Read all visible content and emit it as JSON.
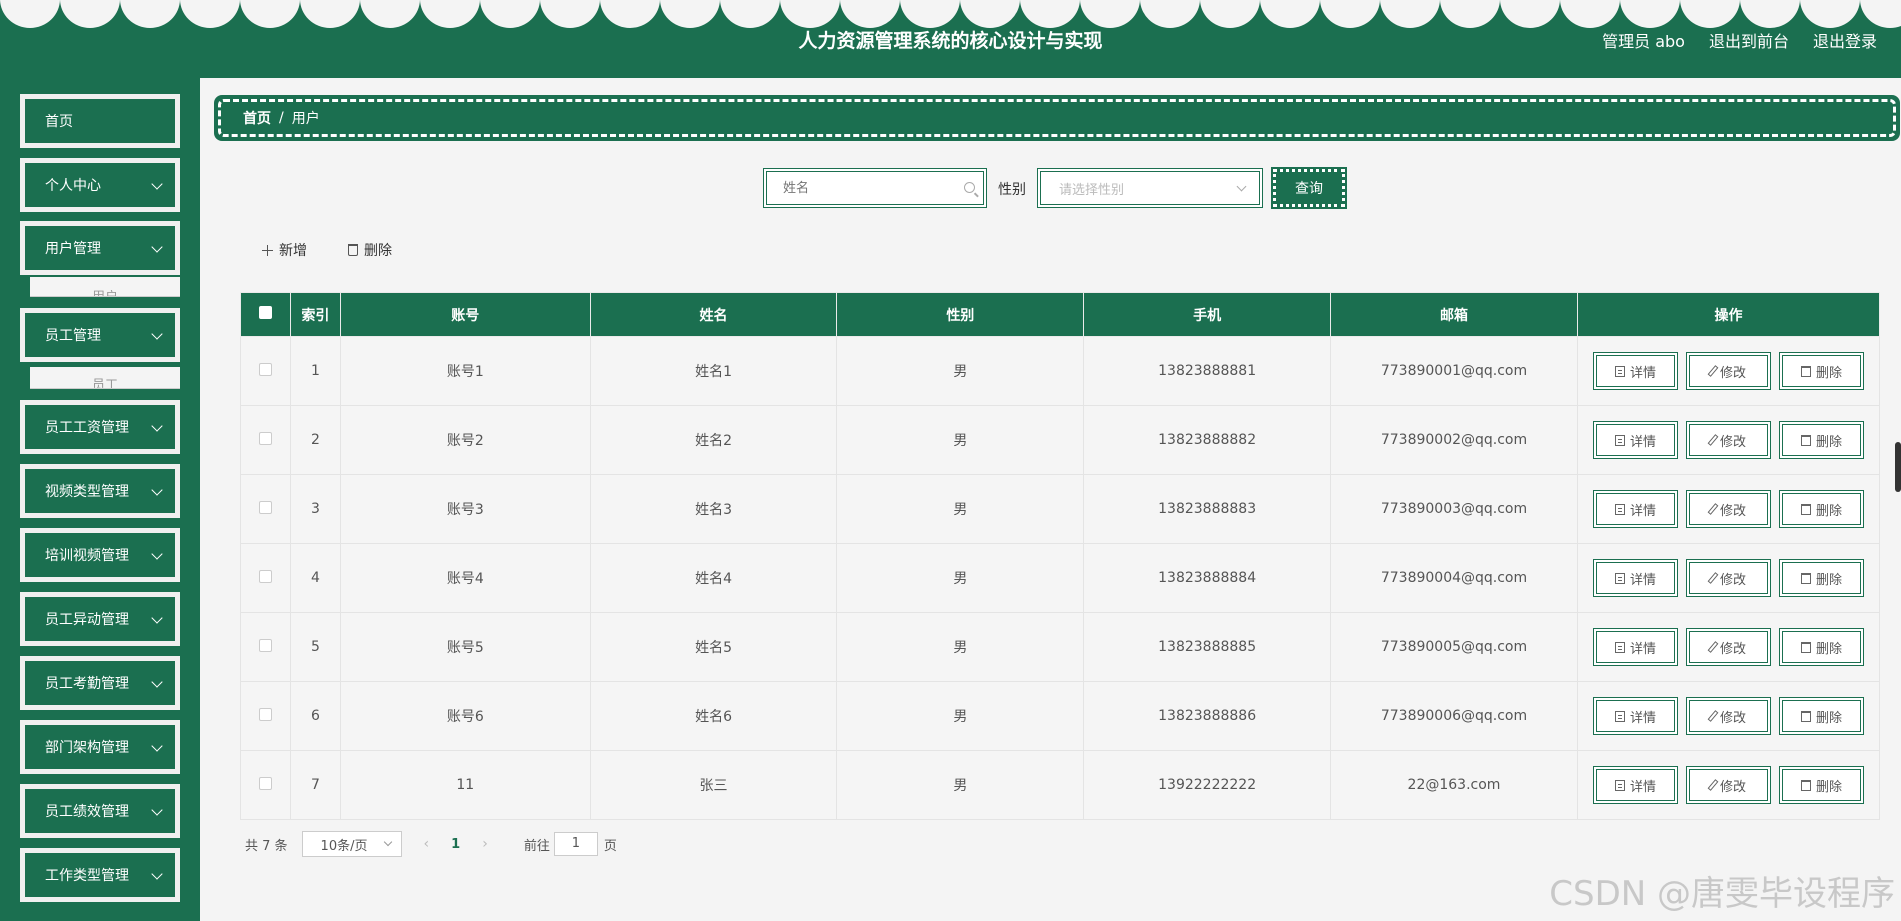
{
  "header": {
    "title": "人力资源管理系统的核心设计与实现",
    "admin": "管理员 abo",
    "to_front": "退出到前台",
    "logout": "退出登录"
  },
  "sidebar": {
    "items": [
      {
        "label": "首页",
        "has_arrow": false
      },
      {
        "label": "个人中心",
        "has_arrow": true
      },
      {
        "label": "用户管理",
        "has_arrow": true
      },
      {
        "label": "员工管理",
        "has_arrow": true
      },
      {
        "label": "员工工资管理",
        "has_arrow": true
      },
      {
        "label": "视频类型管理",
        "has_arrow": true
      },
      {
        "label": "培训视频管理",
        "has_arrow": true
      },
      {
        "label": "员工异动管理",
        "has_arrow": true
      },
      {
        "label": "员工考勤管理",
        "has_arrow": true
      },
      {
        "label": "部门架构管理",
        "has_arrow": true
      },
      {
        "label": "员工绩效管理",
        "has_arrow": true
      },
      {
        "label": "工作类型管理",
        "has_arrow": true
      }
    ],
    "sub_user": "用户",
    "sub_employee": "员工"
  },
  "breadcrumb": {
    "home": "首页",
    "sep": "/",
    "current": "用户"
  },
  "search": {
    "name_placeholder": "姓名",
    "gender_label": "性别",
    "gender_placeholder": "请选择性别",
    "query_label": "查询"
  },
  "actions": {
    "add": "新增",
    "delete": "删除"
  },
  "table": {
    "headers": [
      "索引",
      "账号",
      "姓名",
      "性别",
      "手机",
      "邮箱",
      "操作"
    ],
    "rows": [
      {
        "idx": "1",
        "account": "账号1",
        "name": "姓名1",
        "gender": "男",
        "phone": "13823888881",
        "email": "773890001@qq.com"
      },
      {
        "idx": "2",
        "account": "账号2",
        "name": "姓名2",
        "gender": "男",
        "phone": "13823888882",
        "email": "773890002@qq.com"
      },
      {
        "idx": "3",
        "account": "账号3",
        "name": "姓名3",
        "gender": "男",
        "phone": "13823888883",
        "email": "773890003@qq.com"
      },
      {
        "idx": "4",
        "account": "账号4",
        "name": "姓名4",
        "gender": "男",
        "phone": "13823888884",
        "email": "773890004@qq.com"
      },
      {
        "idx": "5",
        "account": "账号5",
        "name": "姓名5",
        "gender": "男",
        "phone": "13823888885",
        "email": "773890005@qq.com"
      },
      {
        "idx": "6",
        "account": "账号6",
        "name": "姓名6",
        "gender": "男",
        "phone": "13823888886",
        "email": "773890006@qq.com"
      },
      {
        "idx": "7",
        "account": "11",
        "name": "张三",
        "gender": "男",
        "phone": "13922222222",
        "email": "22@163.com"
      }
    ],
    "op_detail": "详情",
    "op_edit": "修改",
    "op_delete": "删除"
  },
  "pager": {
    "total": "共 7 条",
    "size": "10条/页",
    "prev": "‹",
    "current": "1",
    "next": "›",
    "goto": "前往",
    "goto_value": "1",
    "page_unit": "页"
  },
  "watermark": "CSDN @唐雯毕设程序",
  "colors": {
    "primary": "#1b6f50",
    "background": "#f4f4f4"
  }
}
